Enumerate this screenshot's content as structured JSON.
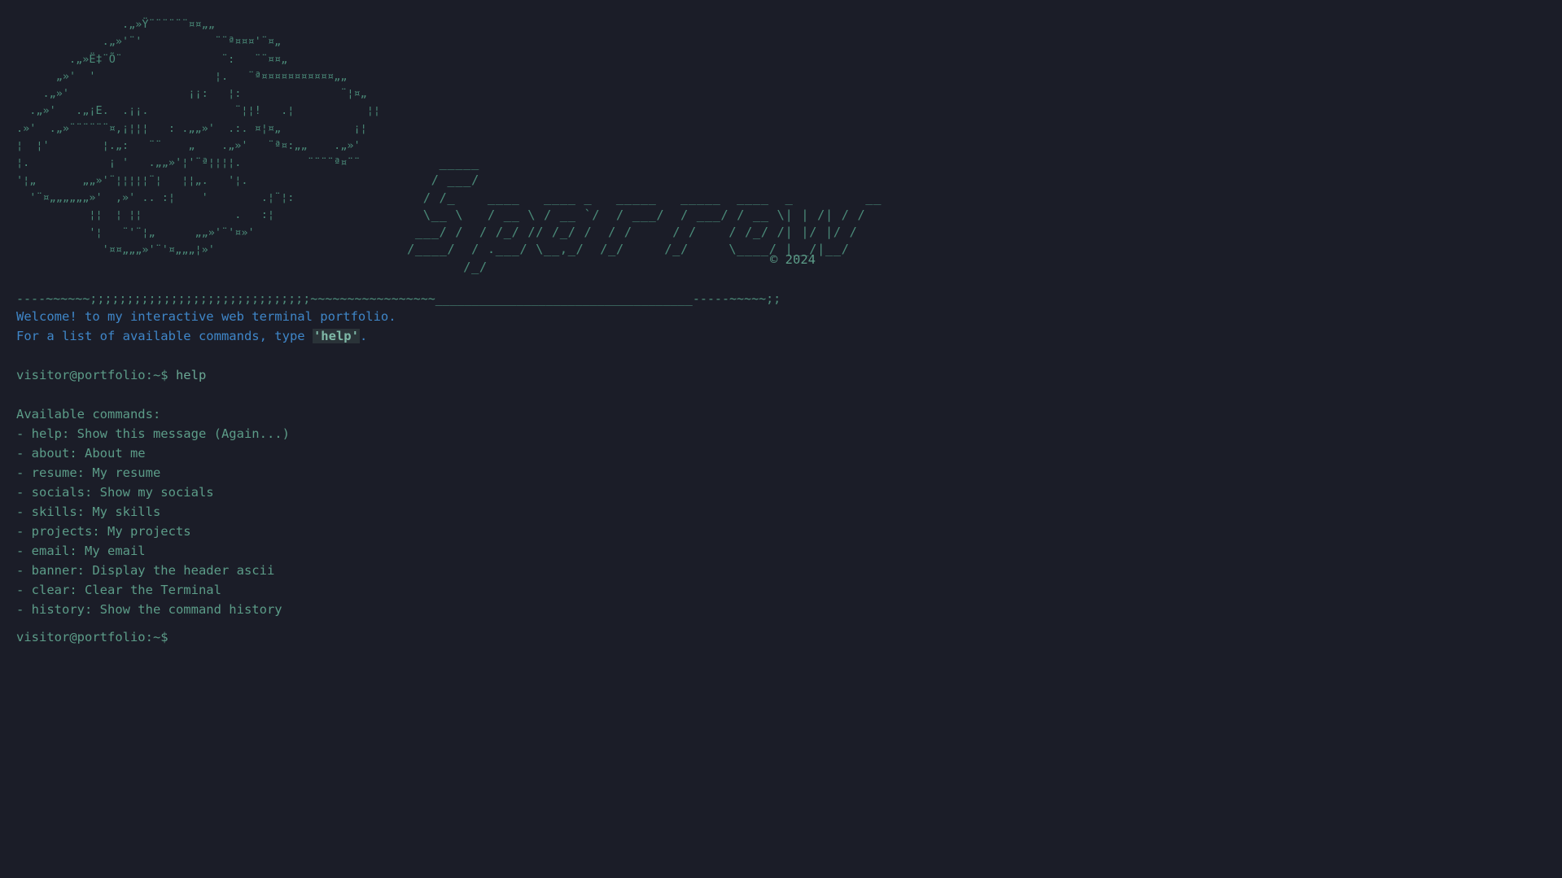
{
  "banner": {
    "ascii_art": "                .„»Ÿ¨¨¨¨¨¨¤¤„„\n             .„»'¨'           ¨¨ª¤¤¤'¨¤„\n        .„»Ë‡¨Õ¨               ¨:   ¨¨¤¤„\n      „»'  '                  ¦.   ¨ª¤¤¤¤¤¤¤¤¤¤¤„„\n    .„»'                  ¡¡:   ¦:               ¨¦¤„\n  .„»'   .„¡E.  .¡¡.             ¨¦¦!   .¦           ¦¦\n.»'  .„»¨¨¨¨¨¨¤,¡¦¦¦   : .„„»'  .:. ¤¦¤„           ¡¦\n¦  ¦'        ¦.„:   ¨¨    „    .„»'   ¨ª¤:„„    .„»'\n¦.            ¡ '   .„„»'¦'¨ª¦¦¦¦.          ¨¨¨¨ª¤¨¨\n'¦„       „„»'¨¦¦¦¦¦¨¦   ¦¦„.   '¦.\n  '¨¤„„„„„„»'  ,»' .. :¦    '        .¦¨¦:\n           ¦¦  ¦ ¦¦              .   :¦\n           '¦   ¨'¨¦„      „„»'¨'¤»'\n             '¤¤„„„»'¨'¤„„„¦»'",
    "ascii_name": "    _____\n   / ___/\n  / /_    ____   ____ _   _____   _____  ____  _         __\n  \\__ \\   / __ \\ / __ `/  / ___/  / ___/ / __ \\| | /| / /\n ___/ /  / /_/ // /_/ /  / /     / /    / /_/ /| |/ |/ /\n/____/  / .___/ \\__,_/  /_/     /_/     \\____/ |__/|__/\n       /_/",
    "copyright": "© 2024"
  },
  "divider": "----~~~~~~;;;;;;;;;;;;;;;;;;;;;;;;;;;;;;~~~~~~~~~~~~~~~~~___________________________________-----~~~~~;;",
  "welcome": {
    "line1": "Welcome! to my interactive web terminal portfolio.",
    "line2_prefix": "For a list of available commands, type ",
    "line2_highlight": "'help'",
    "line2_suffix": "."
  },
  "history": {
    "prompt": "visitor@portfolio:~$",
    "command": " help"
  },
  "help_output": {
    "heading": "Available commands:",
    "items": [
      "- help: Show this message (Again...)",
      "- about: About me",
      "- resume: My resume",
      "- socials: Show my socials",
      "- skills: My skills",
      "- projects: My projects",
      "- email: My email",
      "- banner: Display the header ascii",
      "- clear: Clear the Terminal",
      "- history: Show the command history"
    ]
  },
  "input": {
    "prompt": "visitor@portfolio:~$",
    "value": ""
  },
  "colors": {
    "background": "#1b1d28",
    "text": "#5c9c88",
    "welcome": "#3f86c8"
  }
}
